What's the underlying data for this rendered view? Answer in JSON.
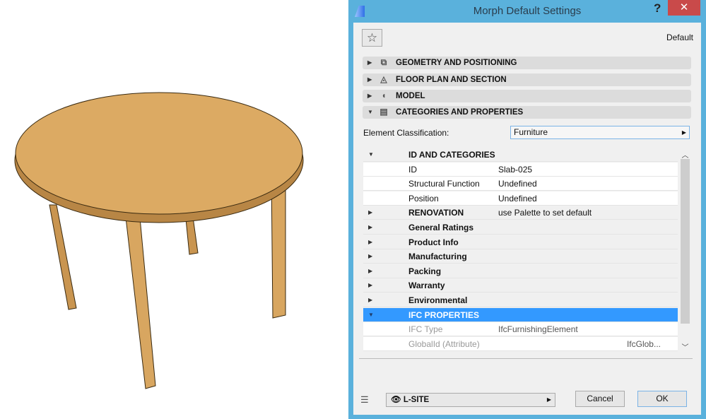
{
  "dialog": {
    "title": "Morph Default Settings",
    "help": "?",
    "close": "✕",
    "favorite_icon": "star-icon",
    "preset_label": "Default"
  },
  "sections": [
    {
      "label": "GEOMETRY AND POSITIONING",
      "icon": "geometry-icon",
      "expanded": false
    },
    {
      "label": "FLOOR PLAN AND SECTION",
      "icon": "floor-plan-icon",
      "expanded": false
    },
    {
      "label": "MODEL",
      "icon": "model-icon",
      "expanded": false
    },
    {
      "label": "CATEGORIES AND PROPERTIES",
      "icon": "document-icon",
      "expanded": true
    }
  ],
  "classification": {
    "label": "Element Classification:",
    "value": "Furniture"
  },
  "tree": [
    {
      "type": "grp",
      "expanded": true,
      "key": "ID AND CATEGORIES",
      "value": ""
    },
    {
      "type": "leaf",
      "key": "ID",
      "value": "Slab-025"
    },
    {
      "type": "leaf",
      "key": "Structural Function",
      "value": "Undefined"
    },
    {
      "type": "leaf",
      "key": "Position",
      "value": "Undefined"
    },
    {
      "type": "grp",
      "expanded": false,
      "key": "RENOVATION",
      "value": "use Palette to set default"
    },
    {
      "type": "grp",
      "expanded": false,
      "key": "General Ratings",
      "value": ""
    },
    {
      "type": "grp",
      "expanded": false,
      "key": "Product Info",
      "value": ""
    },
    {
      "type": "grp",
      "expanded": false,
      "key": "Manufacturing",
      "value": ""
    },
    {
      "type": "grp",
      "expanded": false,
      "key": "Packing",
      "value": ""
    },
    {
      "type": "grp",
      "expanded": false,
      "key": "Warranty",
      "value": ""
    },
    {
      "type": "grp",
      "expanded": false,
      "key": "Environmental",
      "value": ""
    },
    {
      "type": "sel",
      "expanded": true,
      "key": "IFC PROPERTIES",
      "value": ""
    },
    {
      "type": "dim",
      "key": "IFC Type",
      "value": "IfcFurnishingElement"
    },
    {
      "type": "dim2",
      "key": "GlobalId (Attribute)",
      "value": "IfcGlob..."
    }
  ],
  "footer": {
    "layer": "L-SITE",
    "cancel": "Cancel",
    "ok": "OK"
  },
  "colors": {
    "selection": "#3399ff",
    "titlebar": "#5ab1dc",
    "close": "#c94a4a",
    "wood": "#d9a760"
  }
}
